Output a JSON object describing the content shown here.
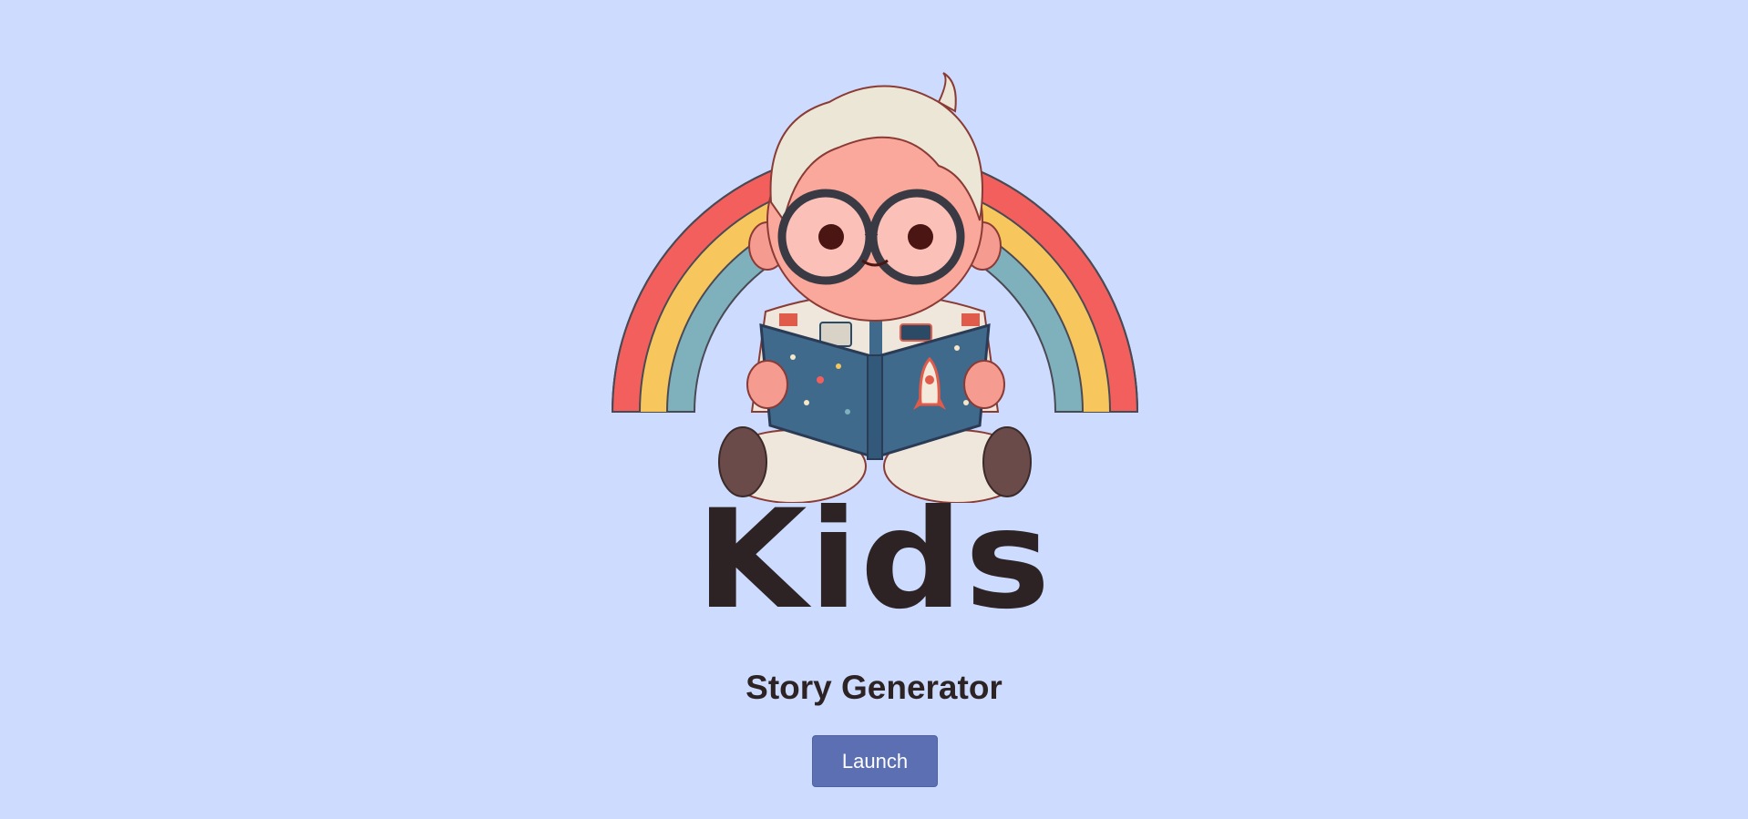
{
  "hero": {
    "image_name": "astronaut-kid-reading-book-with-rainbow"
  },
  "title": "Kids",
  "subtitle": "Story Generator",
  "launch_button": {
    "label": "Launch"
  },
  "colors": {
    "background": "#cddcfe",
    "text": "#2d2324",
    "button": "#5b6fb2",
    "rainbow_red": "#f25f5c",
    "rainbow_yellow": "#f7c75e",
    "rainbow_teal": "#7fb1bd"
  }
}
